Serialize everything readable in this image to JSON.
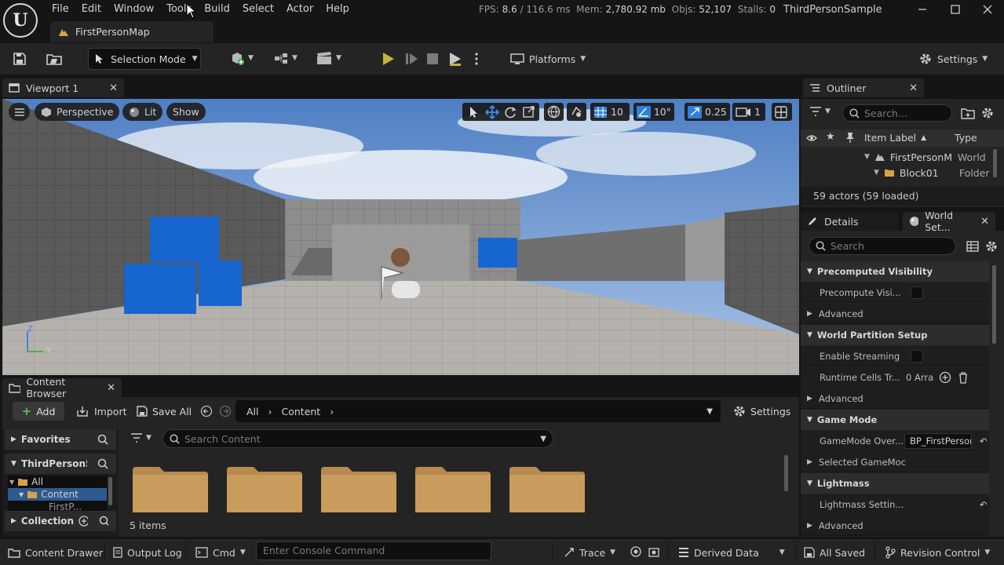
{
  "menu": [
    "File",
    "Edit",
    "Window",
    "Tools",
    "Build",
    "Select",
    "Actor",
    "Help"
  ],
  "stats": {
    "fps_label": "FPS:",
    "fps": "8.6",
    "ms": "/ 116.6 ms",
    "mem_label": "Mem:",
    "mem": "2,780.92 mb",
    "objs_label": "Objs:",
    "objs": "52,107",
    "stalls_label": "Stalls:",
    "stalls": "0"
  },
  "project_name": "ThirdPersonSample",
  "map_tab": "FirstPersonMap",
  "toolbar": {
    "selection_mode": "Selection Mode",
    "platforms": "Platforms",
    "settings": "Settings"
  },
  "viewport": {
    "tab": "Viewport 1",
    "perspective": "Perspective",
    "lit": "Lit",
    "show": "Show",
    "grid_snap": "10",
    "rot_snap": "10°",
    "scale_snap": "0.25",
    "camera_speed": "1",
    "axis_y": "Y",
    "axis_z": "Z"
  },
  "outliner": {
    "tab": "Outliner",
    "search_placeholder": "Search...",
    "col_label": "Item Label",
    "col_type": "Type",
    "rows": [
      {
        "label": "FirstPersonM",
        "type": "World"
      },
      {
        "label": "Block01",
        "type": "Folder"
      }
    ],
    "footer": "59 actors (59 loaded)"
  },
  "details": {
    "tab": "Details",
    "tab2": "World Set...",
    "search_placeholder": "Search",
    "rows": [
      {
        "kind": "section",
        "label": "Precomputed Visibility"
      },
      {
        "kind": "check",
        "label": "Precompute Visi..."
      },
      {
        "kind": "adv",
        "label": "Advanced"
      },
      {
        "kind": "section",
        "label": "World Partition Setup"
      },
      {
        "kind": "check",
        "label": "Enable Streaming"
      },
      {
        "kind": "array",
        "label": "Runtime Cells Tr...",
        "value": "0 Arra"
      },
      {
        "kind": "adv",
        "label": "Advanced"
      },
      {
        "kind": "section",
        "label": "Game Mode"
      },
      {
        "kind": "field",
        "label": "GameMode Over...",
        "value": "BP_FirstPerson"
      },
      {
        "kind": "adv",
        "label": "Selected GameMoc"
      },
      {
        "kind": "section",
        "label": "Lightmass"
      },
      {
        "kind": "reset",
        "label": "Lightmass Settin..."
      },
      {
        "kind": "adv",
        "label": "Advanced"
      }
    ]
  },
  "content_browser": {
    "tab": "Content Browser",
    "add": "Add",
    "import": "Import",
    "save_all": "Save All",
    "breadcrumb": [
      "All",
      "Content"
    ],
    "settings": "Settings",
    "favorites": "Favorites",
    "project": "ThirdPersonSa",
    "tree": [
      "All",
      "Content",
      "FirstP..."
    ],
    "collection": "Collection",
    "search_placeholder": "Search Content",
    "item_count": "5 items"
  },
  "statusbar": {
    "content_drawer": "Content Drawer",
    "output_log": "Output Log",
    "cmd": "Cmd",
    "console_placeholder": "Enter Console Command",
    "trace": "Trace",
    "derived_data": "Derived Data",
    "all_saved": "All Saved",
    "revision_control": "Revision Control"
  }
}
